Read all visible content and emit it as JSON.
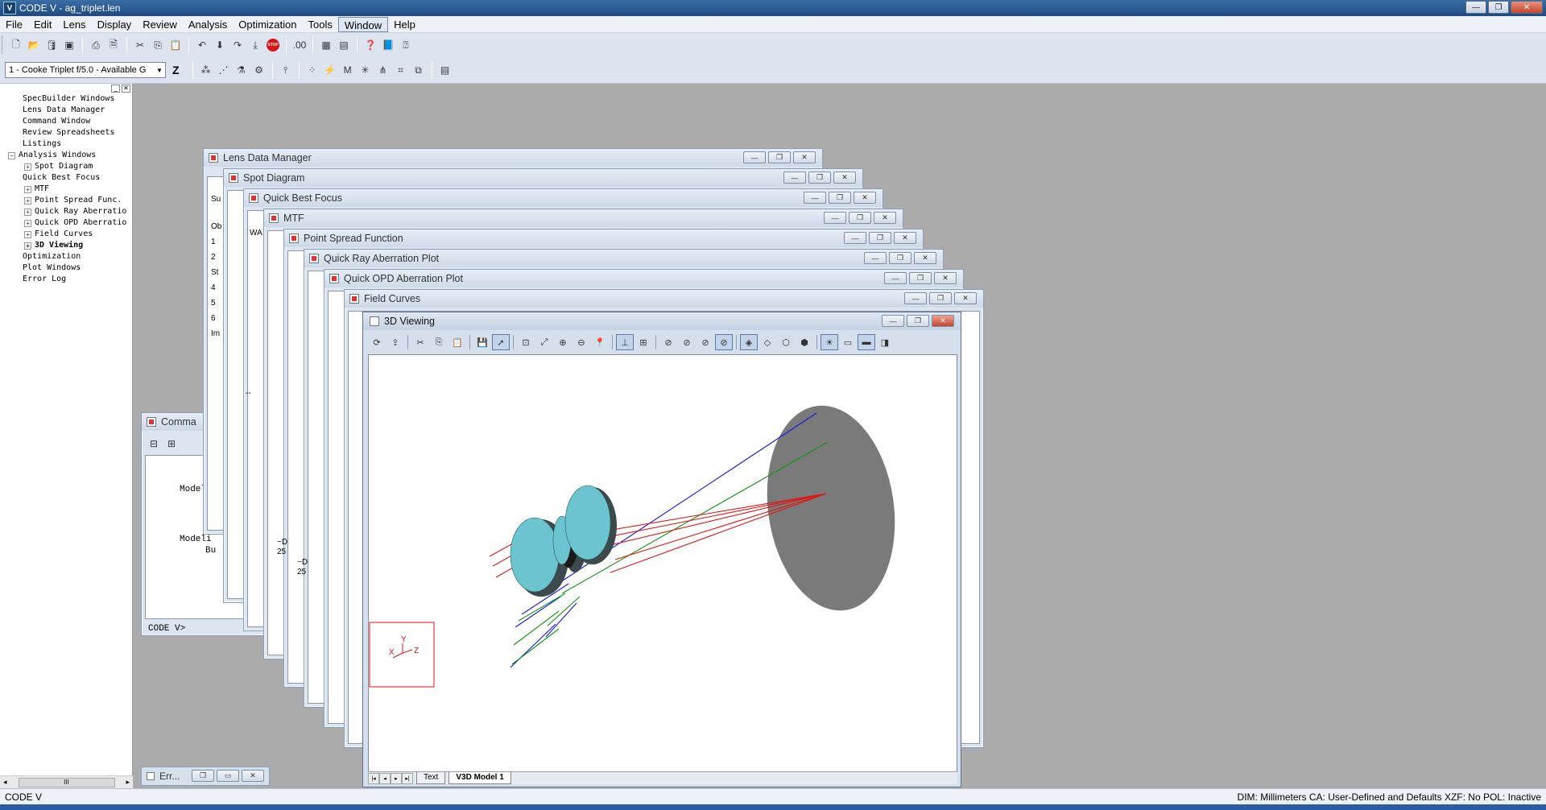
{
  "app": {
    "title": "CODE V - ag_triplet.len",
    "icon_label": "V",
    "window_buttons": [
      "—",
      "❐",
      "✕"
    ]
  },
  "menu": [
    "File",
    "Edit",
    "Lens",
    "Display",
    "Review",
    "Analysis",
    "Optimization",
    "Tools",
    "Window",
    "Help"
  ],
  "menu_active": "Window",
  "toolbar2": {
    "lens_selector": "1 - Cooke Triplet f/5.0 - Available G",
    "z_label": "Z"
  },
  "tree": [
    {
      "label": "SpecBuilder Windows",
      "level": 0,
      "expander": false
    },
    {
      "label": "Lens Data Manager",
      "level": 0,
      "expander": false
    },
    {
      "label": "Command Window",
      "level": 0,
      "expander": false
    },
    {
      "label": "Review Spreadsheets",
      "level": 0,
      "expander": false
    },
    {
      "label": "Listings",
      "level": 0,
      "expander": false
    },
    {
      "label": "Analysis Windows",
      "level": 0,
      "expander": true,
      "sign": "−"
    },
    {
      "label": "Spot Diagram",
      "level": 1,
      "expander": true,
      "sign": "+"
    },
    {
      "label": "Quick Best Focus",
      "level": 1,
      "expander": false
    },
    {
      "label": "MTF",
      "level": 1,
      "expander": true,
      "sign": "+"
    },
    {
      "label": "Point Spread Func.",
      "level": 1,
      "expander": true,
      "sign": "+"
    },
    {
      "label": "Quick Ray Aberratio",
      "level": 1,
      "expander": true,
      "sign": "+"
    },
    {
      "label": "Quick OPD Aberratio",
      "level": 1,
      "expander": true,
      "sign": "+"
    },
    {
      "label": "Field Curves",
      "level": 1,
      "expander": true,
      "sign": "+"
    },
    {
      "label": "3D Viewing",
      "level": 1,
      "expander": true,
      "sign": "+",
      "bold": true
    },
    {
      "label": "Optimization",
      "level": 0,
      "expander": false
    },
    {
      "label": "Plot Windows",
      "level": 0,
      "expander": false
    },
    {
      "label": "Error Log",
      "level": 0,
      "expander": false
    }
  ],
  "tree_scroll_thumb": "III",
  "windows": {
    "lens_data_manager": "Lens Data Manager",
    "spot_diagram": "Spot Diagram",
    "quick_best_focus": "Quick Best Focus",
    "mtf": "MTF",
    "psf": "Point Spread Function",
    "quick_ray": "Quick Ray Aberration Plot",
    "quick_opd": "Quick OPD Aberration Plot",
    "field_curves": "Field Curves",
    "viewing_3d": "3D Viewing",
    "command": "Comma",
    "error_log": "Err..."
  },
  "ldm_rows": [
    "Su",
    "Ob",
    "1",
    "2",
    "St",
    "4",
    "5",
    "6",
    "Im"
  ],
  "qbf_snippet": "WA",
  "dash_snippet": "--",
  "snippets": {
    "a": "~D",
    "b": "25",
    "c": "~D",
    "d": "25"
  },
  "command": {
    "lines": [
      "Modeli",
      "Bu",
      "Modeli",
      "Bu"
    ],
    "prompt": "CODE V>"
  },
  "viewer": {
    "tabs": [
      "Text",
      "V3D Model 1"
    ],
    "selected_tab": "V3D Model 1",
    "axis_labels": {
      "x": "X",
      "y": "Y",
      "z": "Z"
    }
  },
  "status": {
    "left": "CODE V",
    "right": "DIM: Millimeters  CA: User-Defined and Defaults  XZF: No    POL: Inactive"
  },
  "colors": {
    "lens": "#6cc4cf",
    "image_plane": "#7a7a7a",
    "ray_blue": "#1515e0",
    "ray_green": "#139413",
    "ray_red": "#e01515"
  }
}
